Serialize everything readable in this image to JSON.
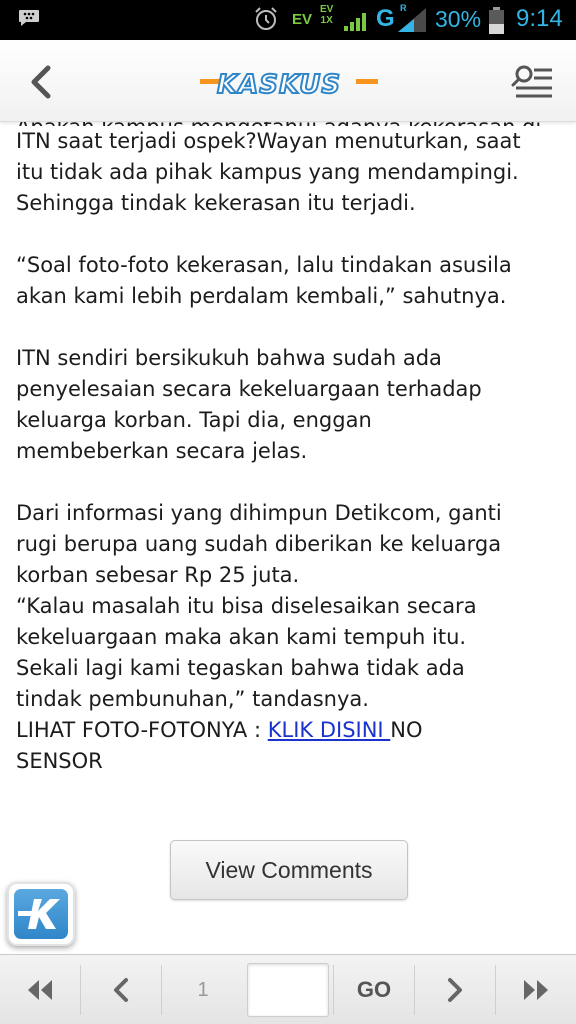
{
  "status_bar": {
    "ev": "EV",
    "ev_top": "EV",
    "ev_bottom": "1X",
    "network": "G",
    "roaming": "R",
    "battery": "30%",
    "time": "9:14",
    "accent_color": "#33b5e5"
  },
  "header": {
    "logo_text": "KASKUS",
    "back_icon": "chevron-left-icon",
    "menu_icon": "search-list-icon"
  },
  "article": {
    "partial_line": "Apakah kampus mengetahui adanya kekerasan di dalam",
    "paragraphs": [
      "ITN saat terjadi ospek?Wayan menuturkan, saat\nitu tidak ada pihak kampus yang mendampingi.\nSehingga tindak kekerasan itu terjadi.",
      "“Soal foto-foto kekerasan, lalu tindakan asusila\nakan kami lebih perdalam kembali,” sahutnya.",
      "ITN sendiri bersikukuh bahwa sudah ada\npenyelesaian secara kekeluargaan terhadap\nkeluarga korban. Tapi dia, enggan\nmembeberkan secara jelas."
    ],
    "last_block": "Dari informasi yang dihimpun Detikcom, ganti\nrugi berupa uang sudah diberikan ke keluarga\nkorban sebesar Rp 25 juta.\n“Kalau masalah itu bisa diselesaikan secara\nkekeluargaan maka akan kami tempuh itu.\nSekali lagi kami tegaskan bahwa tidak ada\ntindak pembunuhan,” tandasnya.",
    "link_prefix": "LIHAT FOTO-FOTONYA : ",
    "link_text": "KLIK DISINI ",
    "link_suffix": "NO\nSENSOR"
  },
  "view_comments_label": "View Comments",
  "pager": {
    "first_icon": "double-chevron-left-icon",
    "prev_icon": "chevron-left-icon",
    "page_number": "1",
    "page_input_value": "",
    "go_label": "GO",
    "next_icon": "chevron-right-icon",
    "last_icon": "double-chevron-right-icon"
  },
  "colors": {
    "link": "#1a33cc",
    "logo_blue": "#2f86c8",
    "logo_orange": "#f7941d"
  }
}
